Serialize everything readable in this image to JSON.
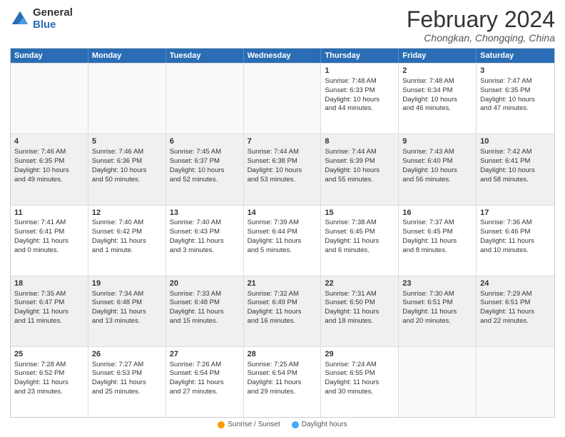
{
  "logo": {
    "general": "General",
    "blue": "Blue"
  },
  "title": {
    "month_year": "February 2024",
    "location": "Chongkan, Chongqing, China"
  },
  "weekdays": [
    "Sunday",
    "Monday",
    "Tuesday",
    "Wednesday",
    "Thursday",
    "Friday",
    "Saturday"
  ],
  "legend": {
    "sunrise_label": "Sunrise / Sunset",
    "daylight_label": "Daylight hours"
  },
  "weeks": [
    {
      "days": [
        {
          "num": "",
          "info": "",
          "empty": true
        },
        {
          "num": "",
          "info": "",
          "empty": true
        },
        {
          "num": "",
          "info": "",
          "empty": true
        },
        {
          "num": "",
          "info": "",
          "empty": true
        },
        {
          "num": "1",
          "info": "Sunrise: 7:48 AM\nSunset: 6:33 PM\nDaylight: 10 hours\nand 44 minutes."
        },
        {
          "num": "2",
          "info": "Sunrise: 7:48 AM\nSunset: 6:34 PM\nDaylight: 10 hours\nand 46 minutes."
        },
        {
          "num": "3",
          "info": "Sunrise: 7:47 AM\nSunset: 6:35 PM\nDaylight: 10 hours\nand 47 minutes."
        }
      ]
    },
    {
      "days": [
        {
          "num": "4",
          "info": "Sunrise: 7:46 AM\nSunset: 6:35 PM\nDaylight: 10 hours\nand 49 minutes."
        },
        {
          "num": "5",
          "info": "Sunrise: 7:46 AM\nSunset: 6:36 PM\nDaylight: 10 hours\nand 50 minutes."
        },
        {
          "num": "6",
          "info": "Sunrise: 7:45 AM\nSunset: 6:37 PM\nDaylight: 10 hours\nand 52 minutes."
        },
        {
          "num": "7",
          "info": "Sunrise: 7:44 AM\nSunset: 6:38 PM\nDaylight: 10 hours\nand 53 minutes."
        },
        {
          "num": "8",
          "info": "Sunrise: 7:44 AM\nSunset: 6:39 PM\nDaylight: 10 hours\nand 55 minutes."
        },
        {
          "num": "9",
          "info": "Sunrise: 7:43 AM\nSunset: 6:40 PM\nDaylight: 10 hours\nand 56 minutes."
        },
        {
          "num": "10",
          "info": "Sunrise: 7:42 AM\nSunset: 6:41 PM\nDaylight: 10 hours\nand 58 minutes."
        }
      ]
    },
    {
      "days": [
        {
          "num": "11",
          "info": "Sunrise: 7:41 AM\nSunset: 6:41 PM\nDaylight: 11 hours\nand 0 minutes."
        },
        {
          "num": "12",
          "info": "Sunrise: 7:40 AM\nSunset: 6:42 PM\nDaylight: 11 hours\nand 1 minute."
        },
        {
          "num": "13",
          "info": "Sunrise: 7:40 AM\nSunset: 6:43 PM\nDaylight: 11 hours\nand 3 minutes."
        },
        {
          "num": "14",
          "info": "Sunrise: 7:39 AM\nSunset: 6:44 PM\nDaylight: 11 hours\nand 5 minutes."
        },
        {
          "num": "15",
          "info": "Sunrise: 7:38 AM\nSunset: 6:45 PM\nDaylight: 11 hours\nand 6 minutes."
        },
        {
          "num": "16",
          "info": "Sunrise: 7:37 AM\nSunset: 6:45 PM\nDaylight: 11 hours\nand 8 minutes."
        },
        {
          "num": "17",
          "info": "Sunrise: 7:36 AM\nSunset: 6:46 PM\nDaylight: 11 hours\nand 10 minutes."
        }
      ]
    },
    {
      "days": [
        {
          "num": "18",
          "info": "Sunrise: 7:35 AM\nSunset: 6:47 PM\nDaylight: 11 hours\nand 11 minutes."
        },
        {
          "num": "19",
          "info": "Sunrise: 7:34 AM\nSunset: 6:48 PM\nDaylight: 11 hours\nand 13 minutes."
        },
        {
          "num": "20",
          "info": "Sunrise: 7:33 AM\nSunset: 6:48 PM\nDaylight: 11 hours\nand 15 minutes."
        },
        {
          "num": "21",
          "info": "Sunrise: 7:32 AM\nSunset: 6:49 PM\nDaylight: 11 hours\nand 16 minutes."
        },
        {
          "num": "22",
          "info": "Sunrise: 7:31 AM\nSunset: 6:50 PM\nDaylight: 11 hours\nand 18 minutes."
        },
        {
          "num": "23",
          "info": "Sunrise: 7:30 AM\nSunset: 6:51 PM\nDaylight: 11 hours\nand 20 minutes."
        },
        {
          "num": "24",
          "info": "Sunrise: 7:29 AM\nSunset: 6:51 PM\nDaylight: 11 hours\nand 22 minutes."
        }
      ]
    },
    {
      "days": [
        {
          "num": "25",
          "info": "Sunrise: 7:28 AM\nSunset: 6:52 PM\nDaylight: 11 hours\nand 23 minutes."
        },
        {
          "num": "26",
          "info": "Sunrise: 7:27 AM\nSunset: 6:53 PM\nDaylight: 11 hours\nand 25 minutes."
        },
        {
          "num": "27",
          "info": "Sunrise: 7:26 AM\nSunset: 6:54 PM\nDaylight: 11 hours\nand 27 minutes."
        },
        {
          "num": "28",
          "info": "Sunrise: 7:25 AM\nSunset: 6:54 PM\nDaylight: 11 hours\nand 29 minutes."
        },
        {
          "num": "29",
          "info": "Sunrise: 7:24 AM\nSunset: 6:55 PM\nDaylight: 11 hours\nand 30 minutes."
        },
        {
          "num": "",
          "info": "",
          "empty": true
        },
        {
          "num": "",
          "info": "",
          "empty": true
        }
      ]
    }
  ]
}
